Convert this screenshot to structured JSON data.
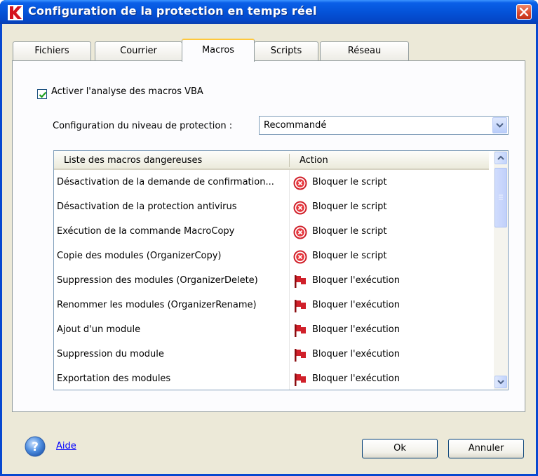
{
  "window": {
    "title": "Configuration de la protection en temps réel"
  },
  "tabs": [
    {
      "label": "Fichiers",
      "active": false
    },
    {
      "label": "Courrier",
      "active": false
    },
    {
      "label": "Macros",
      "active": true
    },
    {
      "label": "Scripts",
      "active": false
    },
    {
      "label": "Réseau",
      "active": false
    }
  ],
  "macros": {
    "enable_checkbox": {
      "label": "Activer l'analyse des macros VBA",
      "checked": true
    },
    "level": {
      "label": "Configuration du niveau de protection :",
      "selected": "Recommandé"
    },
    "table": {
      "columns": [
        "Liste des macros dangereuses",
        "Action"
      ],
      "rows": [
        {
          "name": "Désactivation de la demande de confirmation...",
          "icon": "block-script-icon",
          "action": "Bloquer le script"
        },
        {
          "name": "Désactivation de la protection antivirus",
          "icon": "block-script-icon",
          "action": "Bloquer le script"
        },
        {
          "name": "Exécution de la commande MacroCopy",
          "icon": "block-script-icon",
          "action": "Bloquer le script"
        },
        {
          "name": "Copie des modules (OrganizerCopy)",
          "icon": "block-script-icon",
          "action": "Bloquer le script"
        },
        {
          "name": "Suppression des modules (OrganizerDelete)",
          "icon": "red-flag-icon",
          "action": "Bloquer l'exécution"
        },
        {
          "name": "Renommer les modules (OrganizerRename)",
          "icon": "red-flag-icon",
          "action": "Bloquer l'exécution"
        },
        {
          "name": "Ajout d'un module",
          "icon": "red-flag-icon",
          "action": "Bloquer l'exécution"
        },
        {
          "name": "Suppression du module",
          "icon": "red-flag-icon",
          "action": "Bloquer l'exécution"
        },
        {
          "name": "Exportation des modules",
          "icon": "red-flag-icon",
          "action": "Bloquer l'exécution"
        }
      ]
    }
  },
  "footer": {
    "help_label": "Aide",
    "ok_label": "Ok",
    "cancel_label": "Annuler"
  },
  "colors": {
    "titlebar": "#0453d8",
    "dialog_bg": "#ece9d8",
    "active_tab_accent": "#ffc83c",
    "link": "#0000ff",
    "block_red": "#d0202a"
  }
}
